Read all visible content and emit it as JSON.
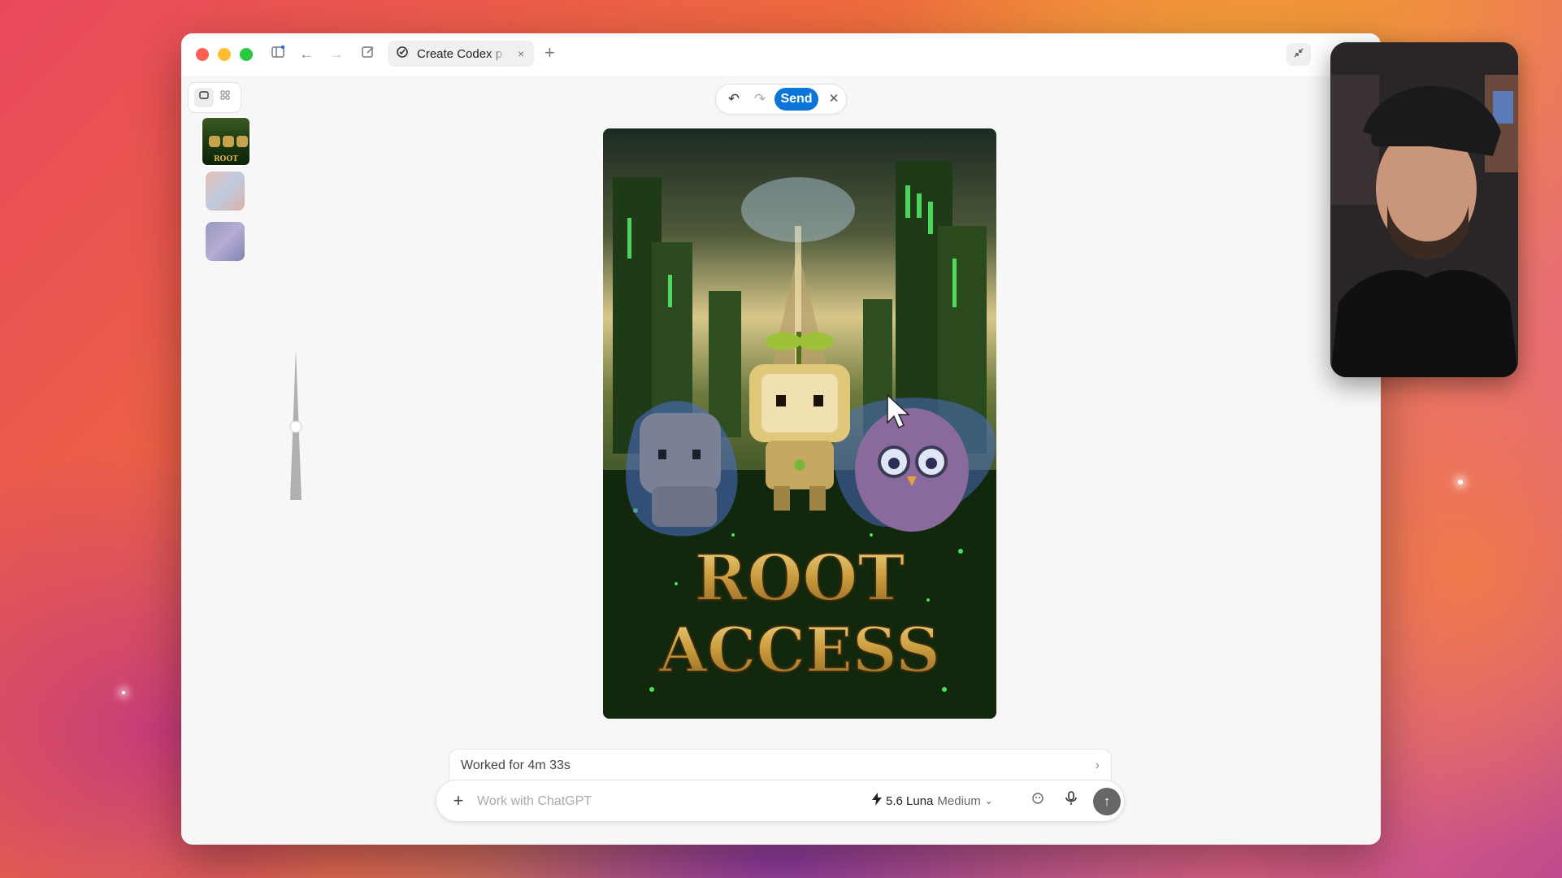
{
  "window": {
    "tab_title": "Create Codex p",
    "tab_close": "×",
    "new_tab": "+"
  },
  "toolbar": {
    "send_label": "Send",
    "undo_icon": "undo-icon",
    "redo_icon": "redo-icon",
    "close_icon": "close-icon"
  },
  "image": {
    "title_line1": "ROOT",
    "title_line2": "ACCESS",
    "thumbnail_caption": "ROOT"
  },
  "status": {
    "worked_label": "Worked for 4m 33s"
  },
  "composer": {
    "placeholder": "Work with ChatGPT",
    "model_name": "5.6 Luna",
    "model_effort": "Medium"
  },
  "colors": {
    "send_button": "#0b76d8",
    "window_bg": "#f7f7f7",
    "title_gold": "#d8b453"
  }
}
